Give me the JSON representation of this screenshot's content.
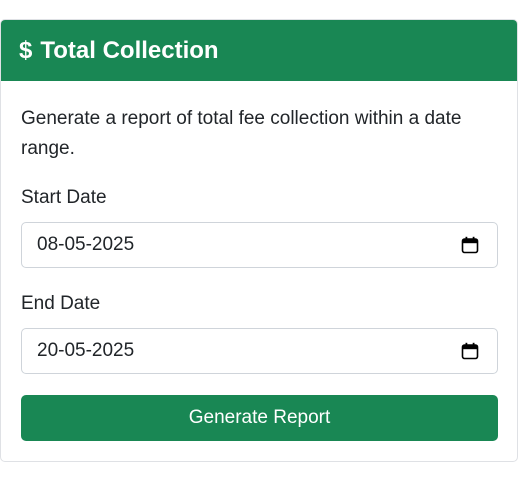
{
  "card": {
    "header": {
      "icon": "$",
      "icon_name": "dollar-icon",
      "title": "Total Collection"
    },
    "description": "Generate a report of total fee collection within a date range.",
    "start_date": {
      "label": "Start Date",
      "value": "08-05-2025"
    },
    "end_date": {
      "label": "End Date",
      "value": "20-05-2025"
    },
    "button_label": "Generate Report"
  },
  "colors": {
    "accent": "#198754",
    "text": "#212529",
    "border": "#cfd4da"
  }
}
